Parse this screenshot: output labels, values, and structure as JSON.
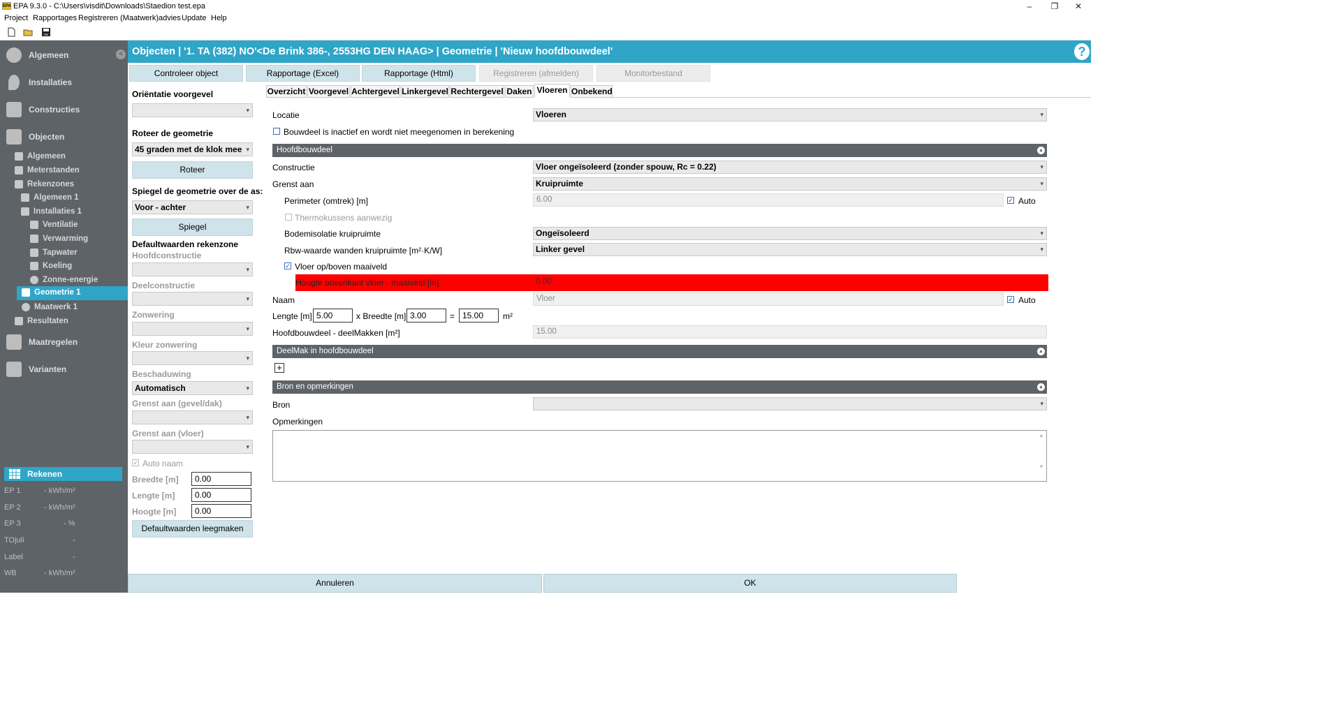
{
  "window": {
    "title": "EPA 9.3.0 - C:\\Users\\visdit\\Downloads\\Staedion test.epa",
    "logo": "EPA",
    "controls": {
      "minimize": "–",
      "maximize": "❐",
      "close": "✕"
    }
  },
  "menu": [
    "Project",
    "Rapportages",
    "Registreren",
    "(Maatwerk)advies",
    "Update",
    "Help"
  ],
  "toolbar_icons": [
    "new-file-icon",
    "open-folder-icon",
    "save-icon"
  ],
  "sidebar": {
    "main": [
      {
        "label": "Algemeen",
        "icon": "gear-icon"
      },
      {
        "label": "Installaties",
        "icon": "flame-icon"
      },
      {
        "label": "Constructies",
        "icon": "grid-icon"
      },
      {
        "label": "Objecten",
        "icon": "building-icon"
      }
    ],
    "objecten_sub": [
      {
        "label": "Algemeen",
        "icon": "letter-a-icon"
      },
      {
        "label": "Meterstanden",
        "icon": "meter-icon"
      },
      {
        "label": "Rekenzones",
        "icon": "zones-icon"
      },
      {
        "label": "Algemeen 1",
        "icon": "letter-a-icon"
      },
      {
        "label": "Installaties 1",
        "icon": "flame-icon"
      },
      {
        "label": "Ventilatie",
        "icon": "vent-icon"
      },
      {
        "label": "Verwarming",
        "icon": "thermometer-icon"
      },
      {
        "label": "Tapwater",
        "icon": "tap-icon"
      },
      {
        "label": "Koeling",
        "icon": "snowflake-icon"
      },
      {
        "label": "Zonne-energie",
        "icon": "sun-icon"
      },
      {
        "label": "Geometrie 1",
        "icon": "grid-icon"
      },
      {
        "label": "Maatwerk 1",
        "icon": "person-icon"
      },
      {
        "label": "Resultaten",
        "icon": "bar-chart-icon"
      }
    ],
    "bottom_main": [
      {
        "label": "Maatregelen",
        "icon": "list-icon"
      },
      {
        "label": "Varianten",
        "icon": "bar-chart-icon"
      }
    ],
    "collapse": "<",
    "rekenen": "Rekenen",
    "results": [
      {
        "label": "EP 1",
        "value": "-  kWh/m²"
      },
      {
        "label": "EP 2",
        "value": "-  kWh/m²"
      },
      {
        "label": "EP 3",
        "value": "-  %"
      },
      {
        "label": "TOjuli",
        "value": "-"
      },
      {
        "label": "Label",
        "value": "-"
      },
      {
        "label": "WB",
        "value": "-  kWh/m²"
      }
    ]
  },
  "header": {
    "title": "Objecten | '1. TA (382) NO'<De Brink 386-, 2553HG DEN HAAG> | Geometrie | 'Nieuw hoofdbouwdeel'",
    "help": "?"
  },
  "top_buttons": [
    {
      "label": "Controleer object",
      "enabled": true
    },
    {
      "label": "Rapportage (Excel)",
      "enabled": true
    },
    {
      "label": "Rapportage (Html)",
      "enabled": true
    },
    {
      "label": "Registreren (afmelden)",
      "enabled": false
    },
    {
      "label": "Monitorbestand",
      "enabled": false
    }
  ],
  "left_panel": {
    "orientatie_label": "Oriëntatie voorgevel",
    "orientatie_value": "",
    "roteer_label": "Roteer de geometrie",
    "roteer_value": "45 graden met de klok mee",
    "roteer_button": "Roteer",
    "spiegel_label": "Spiegel de geometrie over de as:",
    "spiegel_value": "Voor - achter",
    "spiegel_button": "Spiegel",
    "defaults_title": "Defaultwaarden rekenzone",
    "hoofdconstructie_label": "Hoofdconstructie",
    "deelconstructie_label": "Deelconstructie",
    "zonwering_label": "Zonwering",
    "kleur_zonwering_label": "Kleur zonwering",
    "beschaduwing_label": "Beschaduwing",
    "beschaduwing_value": "Automatisch",
    "grens_gevel_label": "Grenst aan (gevel/dak)",
    "grens_vloer_label": "Grenst aan (vloer)",
    "auto_naam_label": "Auto naam",
    "breedte_label": "Breedte [m]",
    "breedte_value": "0.00",
    "lengte_label": "Lengte [m]",
    "lengte_value": "0.00",
    "hoogte_label": "Hoogte [m]",
    "hoogte_value": "0.00",
    "clear_button": "Defaultwaarden leegmaken"
  },
  "tabs": [
    "Overzicht",
    "Voorgevel",
    "Achtergevel",
    "Linkergevel",
    "Rechtergevel",
    "Daken",
    "Vloeren",
    "Onbekend"
  ],
  "active_tab": "Vloeren",
  "form": {
    "locatie_label": "Locatie",
    "locatie_value": "Vloeren",
    "inactief_label": "Bouwdeel is inactief en wordt niet meegenomen in berekening",
    "section_hoofdbouwdeel": "Hoofdbouwdeel",
    "constructie_label": "Constructie",
    "constructie_value": "Vloer ongeïsoleerd (zonder spouw, Rc = 0.22)",
    "grenst_label": "Grenst aan",
    "grenst_value": "Kruipruimte",
    "perimeter_label": "Perimeter (omtrek) [m]",
    "perimeter_value": "6.00",
    "auto_label": "Auto",
    "thermokussens_label": "Thermokussens aanwezig",
    "bodemisolatie_label": "Bodemisolatie kruipruimte",
    "bodemisolatie_value": "Ongeïsoleerd",
    "rbw_label": "Rbw-waarde wanden kruipruimte [m²·K/W]",
    "rbw_value": "Linker gevel",
    "vloer_maaiveld_label": "Vloer op/boven maaiveld",
    "hoogte_label": "Hoogte bovenkant vloer - maaiveld [m]",
    "hoogte_value": "0.00",
    "naam_label": "Naam",
    "naam_value": "Vloer",
    "lengte_label": "Lengte [m]",
    "lengte_value": "5.00",
    "breedte_label": "x Breedte [m]",
    "breedte_value": "3.00",
    "eq": "=",
    "area_value": "15.00",
    "area_unit": "m²",
    "deel_label": "Hoofdbouwdeel - deelMakken [m²]",
    "deel_value": "15.00",
    "section_deelmak": "DeelMak in hoofdbouwdeel",
    "add_symbol": "+",
    "section_bron": "Bron en opmerkingen",
    "bron_label": "Bron",
    "bron_value": "",
    "opmerkingen_label": "Opmerkingen",
    "opmerkingen_value": ""
  },
  "footer": {
    "cancel": "Annuleren",
    "ok": "OK"
  },
  "colors": {
    "accent": "#2fa5c8",
    "sidebar": "#5e6368",
    "error": "#ff0000",
    "button": "#cfe3ea"
  }
}
